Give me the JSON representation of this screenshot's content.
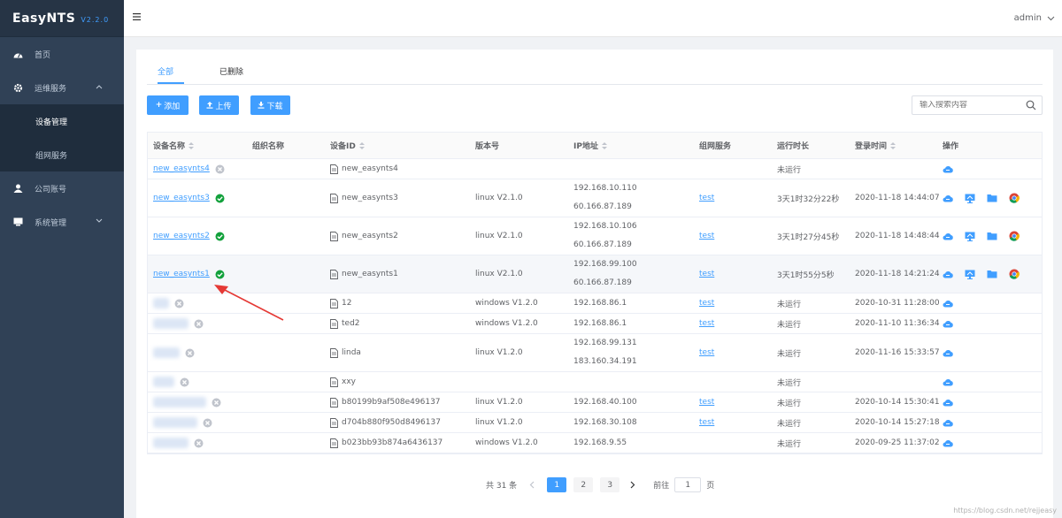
{
  "app": {
    "name": "EasyNTS",
    "version": "V2.2.0"
  },
  "sidebar": {
    "items": [
      {
        "label": "首页",
        "icon": "dashboard-icon"
      },
      {
        "label": "运维服务",
        "icon": "gear-icon"
      },
      {
        "label": "设备管理"
      },
      {
        "label": "组网服务"
      },
      {
        "label": "公司账号",
        "icon": "user-icon"
      },
      {
        "label": "系统管理",
        "icon": "monitor-icon"
      }
    ]
  },
  "topbar": {
    "user": "admin"
  },
  "tabs": [
    "全部",
    "已删除"
  ],
  "toolbar": {
    "add": "添加",
    "upload": "上传",
    "download": "下载"
  },
  "search": {
    "placeholder": "输入搜索内容"
  },
  "table": {
    "headers": [
      "设备名称",
      "组织名称",
      "设备ID",
      "版本号",
      "IP地址",
      "组网服务",
      "运行时长",
      "登录时间",
      "操作"
    ],
    "rows": [
      {
        "name": "new_easynts4",
        "online": false,
        "id": "new_easynts4",
        "version": "",
        "ip": [],
        "net": "",
        "runtime": "未运行",
        "login": ""
      },
      {
        "name": "new_easynts3",
        "online": true,
        "id": "new_easynts3",
        "version": "linux V2.1.0",
        "ip": [
          "192.168.10.110",
          "60.166.87.189"
        ],
        "net": "test",
        "runtime": "3天1时32分22秒",
        "login": "2020-11-18 14:44:07"
      },
      {
        "name": "new_easynts2",
        "online": true,
        "id": "new_easynts2",
        "version": "linux V2.1.0",
        "ip": [
          "192.168.10.106",
          "60.166.87.189"
        ],
        "net": "test",
        "runtime": "3天1时27分45秒",
        "login": "2020-11-18 14:48:44"
      },
      {
        "name": "new_easynts1",
        "online": true,
        "id": "new_easynts1",
        "version": "linux V2.1.0",
        "ip": [
          "192.168.99.100",
          "60.166.87.189"
        ],
        "net": "test",
        "runtime": "3天1时55分5秒",
        "login": "2020-11-18 14:21:24"
      },
      {
        "name": "",
        "online": false,
        "id": "12",
        "version": "windows V1.2.0",
        "ip": [
          "192.168.86.1"
        ],
        "net": "test",
        "runtime": "未运行",
        "login": "2020-10-31 11:28:00"
      },
      {
        "name": "",
        "online": false,
        "id": "ted2",
        "version": "windows V1.2.0",
        "ip": [
          "192.168.86.1"
        ],
        "net": "test",
        "runtime": "未运行",
        "login": "2020-11-10 11:36:34"
      },
      {
        "name": "",
        "online": false,
        "id": "linda",
        "version": "linux V1.2.0",
        "ip": [
          "192.168.99.131",
          "183.160.34.191"
        ],
        "net": "test",
        "runtime": "未运行",
        "login": "2020-11-16 15:33:57"
      },
      {
        "name": "",
        "online": false,
        "id": "xxy",
        "version": "",
        "ip": [],
        "net": "",
        "runtime": "未运行",
        "login": ""
      },
      {
        "name": "",
        "online": false,
        "id": "b80199b9af508e496137",
        "version": "linux V1.2.0",
        "ip": [
          "192.168.40.100"
        ],
        "net": "test",
        "runtime": "未运行",
        "login": "2020-10-14 15:30:41"
      },
      {
        "name": "",
        "online": false,
        "id": "d704b880f950d8496137",
        "version": "linux V1.2.0",
        "ip": [
          "192.168.30.108"
        ],
        "net": "test",
        "runtime": "未运行",
        "login": "2020-10-14 15:27:18"
      },
      {
        "name": "",
        "online": false,
        "id": "b023bb93b874a6436137",
        "version": "windows V1.2.0",
        "ip": [
          "192.168.9.55"
        ],
        "net": "",
        "runtime": "未运行",
        "login": "2020-09-25 11:37:02"
      }
    ]
  },
  "pagination": {
    "total": "共 31 条",
    "pages": [
      "1",
      "2",
      "3"
    ],
    "goto_label": "前往",
    "goto_value": "1",
    "page_suffix": "页"
  },
  "watermark": "https://blog.csdn.net/rejjeasy",
  "colors": {
    "primary": "#409eff",
    "sidebar": "#304156",
    "success": "#13a13c"
  }
}
